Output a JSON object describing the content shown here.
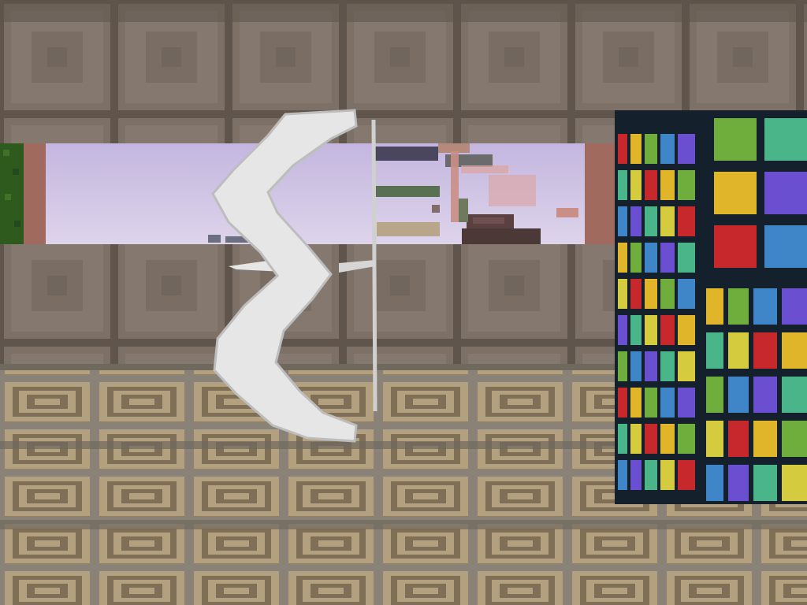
{
  "scene": {
    "type": "first-person voxel game view",
    "held_item": "bow",
    "visible_elements": [
      "stone-brick-ceiling",
      "stone-brick-wall",
      "sky-window",
      "distant-structures",
      "patterned-plank-floor",
      "stained-glass-pillar",
      "bow-item"
    ]
  },
  "colors": {
    "sky": "#c9bde2",
    "sky_bottom": "#d8cfe8",
    "stone": "#7d7167",
    "stone_dark": "#5f554d",
    "stone_light": "#8f8379",
    "floor_light": "#b3a07e",
    "floor_dark": "#7f6f57",
    "floor_grout": "#8a8276",
    "glass_frame": "#14202c",
    "glass_colors": [
      "#c7282c",
      "#e0b52a",
      "#6fae3c",
      "#3f86c8",
      "#6a4fd0",
      "#4bb58a",
      "#d4cc3e"
    ],
    "bow": "#e6e6e6",
    "bow_shadow": "#bdbdbd",
    "leaves": "#2e5a1e",
    "terracotta": "#a06b5e"
  }
}
